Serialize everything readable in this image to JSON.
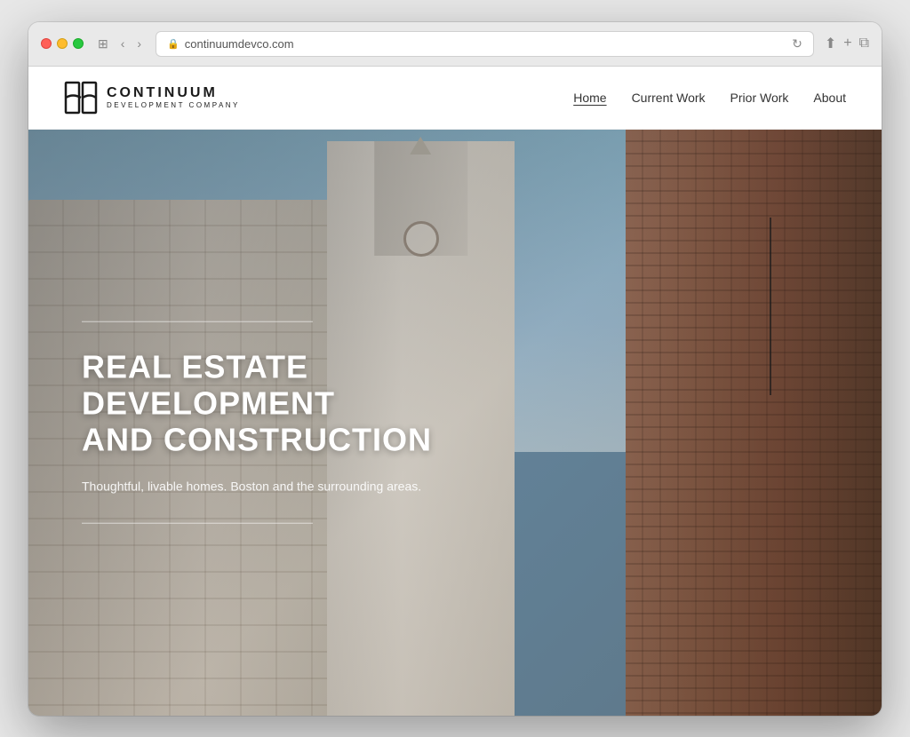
{
  "browser": {
    "url": "continuumdevco.com",
    "back_button": "‹",
    "forward_button": "›",
    "window_icon": "⊞"
  },
  "navbar": {
    "logo_name": "CONTINUUM",
    "logo_sub": "DEVELOPMENT COMPANY",
    "nav_items": [
      {
        "label": "Home",
        "active": true
      },
      {
        "label": "Current Work",
        "active": false
      },
      {
        "label": "Prior Work",
        "active": false
      },
      {
        "label": "About",
        "active": false
      }
    ]
  },
  "hero": {
    "title_line1": "REAL ESTATE",
    "title_line2": "DEVELOPMENT",
    "title_line3": "AND CONSTRUCTION",
    "subtitle": "Thoughtful, livable homes. Boston and the surrounding areas."
  }
}
